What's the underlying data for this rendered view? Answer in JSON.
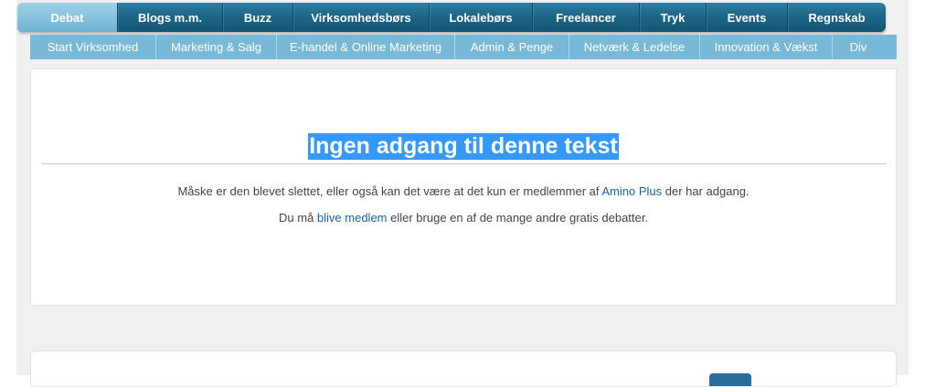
{
  "main_nav": {
    "items": [
      {
        "label": "Debat",
        "active": true
      },
      {
        "label": "Blogs m.m."
      },
      {
        "label": "Buzz"
      },
      {
        "label": "Virksomhedsbørs"
      },
      {
        "label": "Lokalebørs"
      },
      {
        "label": "Freelancer"
      },
      {
        "label": "Tryk"
      },
      {
        "label": "Events"
      },
      {
        "label": "Regnskab"
      }
    ]
  },
  "sub_nav": {
    "items": [
      {
        "label": "Start Virksomhed"
      },
      {
        "label": "Marketing & Salg"
      },
      {
        "label": "E-handel & Online Marketing"
      },
      {
        "label": "Admin & Penge"
      },
      {
        "label": "Netværk & Ledelse"
      },
      {
        "label": "Innovation & Vækst"
      },
      {
        "label": "Div"
      }
    ]
  },
  "content": {
    "title": "Ingen adgang til denne tekst",
    "p1_before": "Måske er den blevet slettet, eller også kan det være at det kun er medlemmer af ",
    "p1_link": "Amino Plus",
    "p1_after": " der har adgang.",
    "p2_before": "Du må ",
    "p2_link": "blive medlem",
    "p2_after": " eller bruge en af de mange andre gratis debatter."
  },
  "colors": {
    "nav_dark": "#1d6688",
    "nav_active": "#6fb3d3",
    "subnav": "#78b9d7",
    "title_highlight": "#3399ff",
    "link": "#1a66a8"
  }
}
